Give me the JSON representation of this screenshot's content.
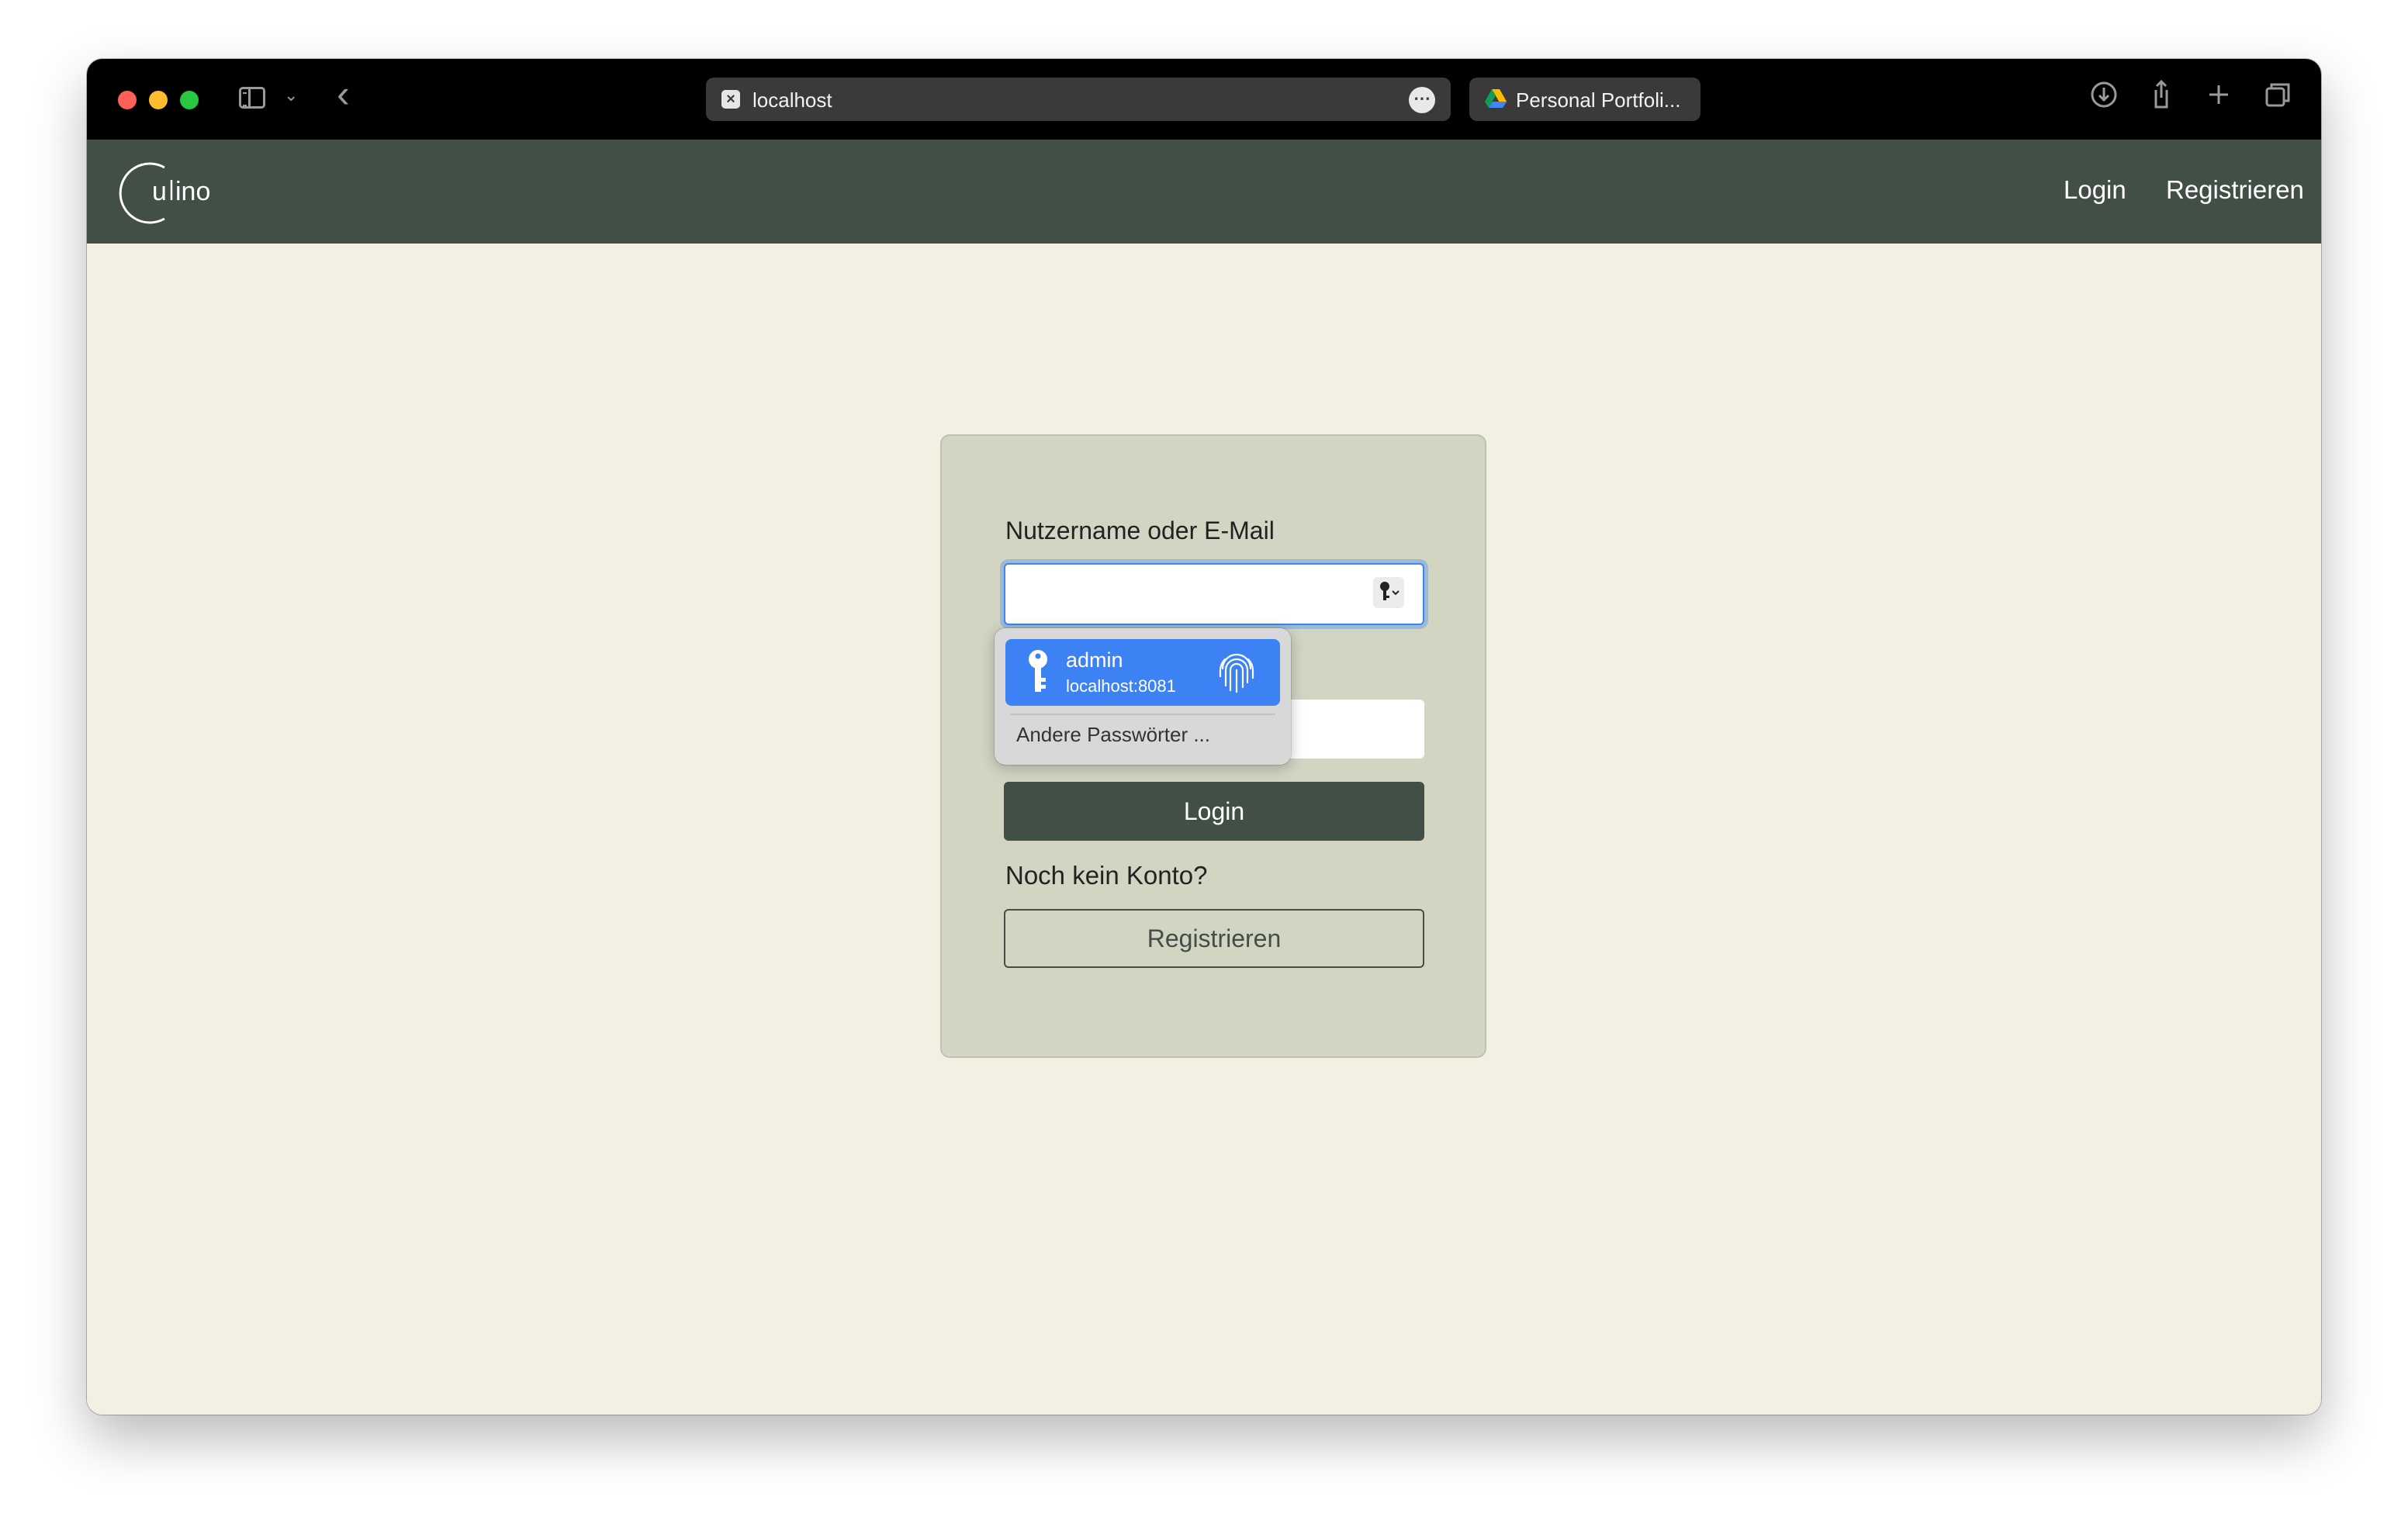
{
  "browser": {
    "address_bar": {
      "text": "localhost"
    },
    "tab2": {
      "title": "Personal Portfoli..."
    }
  },
  "navbar": {
    "login_label": "Login",
    "register_label": "Registrieren"
  },
  "login_form": {
    "username_label": "Nutzername oder E-Mail",
    "username_value": "",
    "password_value": "",
    "login_button": "Login",
    "no_account_text": "Noch kein Konto?",
    "register_button": "Registrieren"
  },
  "autofill": {
    "username": "admin",
    "host": "localhost:8081",
    "other_passwords": "Andere Passwörter ..."
  },
  "colors": {
    "navbar": "#424f47",
    "page_background": "#f3f0e3",
    "card_background": "#d3d5c3",
    "autofill_selected": "#3c82f5"
  }
}
